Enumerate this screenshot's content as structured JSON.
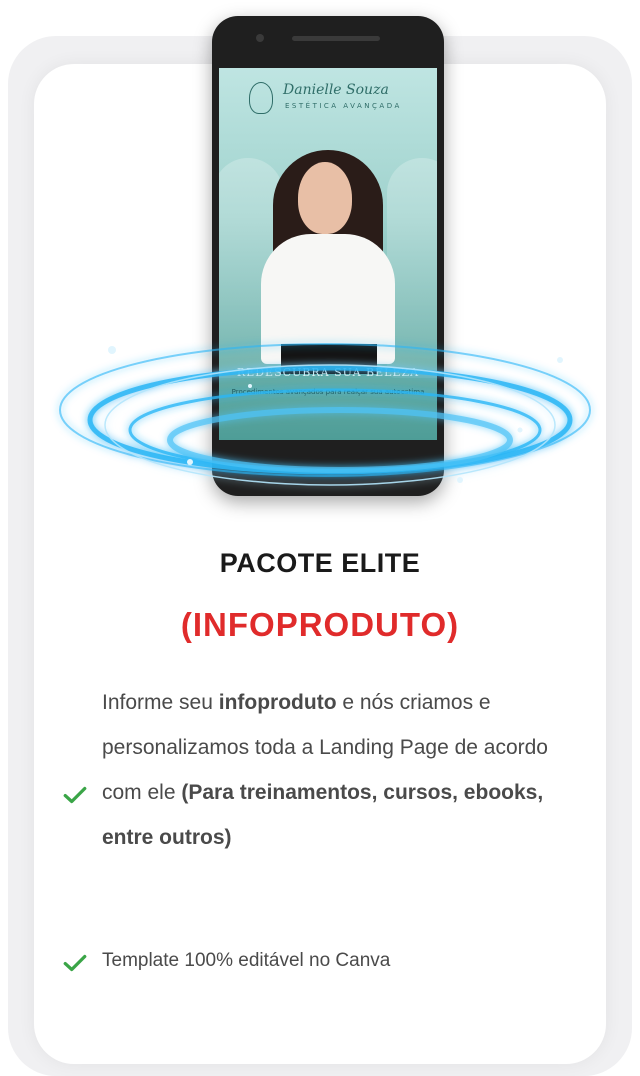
{
  "product": {
    "title": "PACOTE ELITE",
    "subtitle": "(INFOPRODUTO)",
    "subtitle_color": "#e02b2b"
  },
  "mockup": {
    "brand_name": "Danielle Souza",
    "brand_tagline": "ESTÉTICA AVANÇADA",
    "headline": "REDESCUBRA SUA BELEZA",
    "subline": "Procedimentos avançados para realçar sua autoestima"
  },
  "features": [
    {
      "icon": "check-icon",
      "parts": [
        {
          "text": "Informe seu ",
          "bold": false
        },
        {
          "text": "infoproduto",
          "bold": true
        },
        {
          "text": " e nós criamos e personalizamos toda a Landing Page de acordo com ele ",
          "bold": false
        },
        {
          "text": "(Para treinamentos, cursos, ebooks, entre outros)",
          "bold": true
        }
      ]
    },
    {
      "icon": "check-icon",
      "parts": [
        {
          "text": "Template 100% editável no Canva",
          "bold": false
        }
      ]
    }
  ],
  "colors": {
    "check": "#3aa547",
    "swirl": "#29b6f6"
  }
}
